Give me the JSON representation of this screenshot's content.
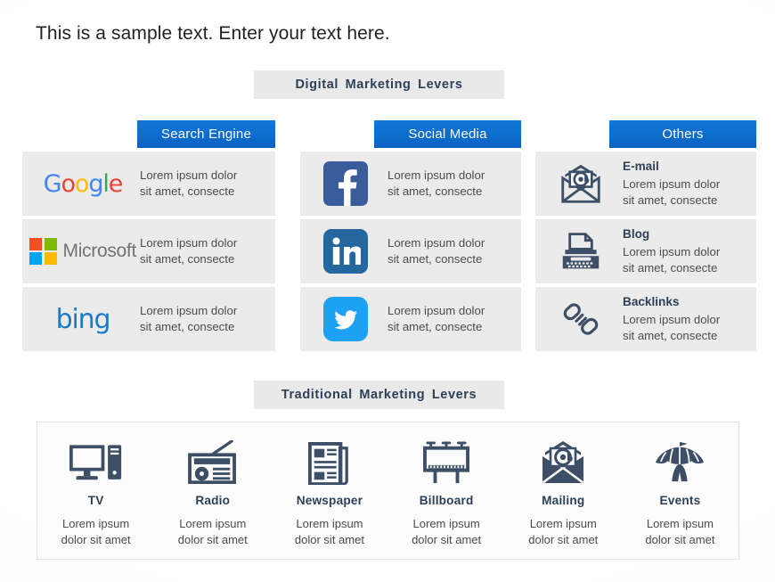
{
  "headline": "This is a sample text. Enter your text here.",
  "sections": {
    "digital_banner": "Digital Marketing Levers",
    "traditional_banner": "Traditional Marketing Levers"
  },
  "colors": {
    "header_blue": "#0d6ed2",
    "banner_gray": "#e9e9e9",
    "card_gray": "#ebebeb",
    "navy_text": "#2e4057",
    "icon_navy": "#3d4f66",
    "facebook_blue": "#3b5c9b",
    "linkedin_blue": "#23679e",
    "twitter_blue": "#1da1f2",
    "bing_blue": "#1a7bc9"
  },
  "digital": {
    "columns": [
      {
        "id": "search-engine",
        "header": "Search Engine",
        "cards": [
          {
            "logo": "google-logo",
            "title": "",
            "line1": "Lorem ipsum dolor",
            "line2": "sit amet, consecte"
          },
          {
            "logo": "microsoft-logo",
            "title": "",
            "line1": "Lorem ipsum dolor",
            "line2": "sit amet, consecte"
          },
          {
            "logo": "bing-logo",
            "title": "",
            "line1": "Lorem ipsum dolor",
            "line2": "sit amet, consecte"
          }
        ]
      },
      {
        "id": "social-media",
        "header": "Social Media",
        "cards": [
          {
            "logo": "facebook-icon",
            "title": "",
            "line1": "Lorem ipsum dolor",
            "line2": "sit amet, consecte"
          },
          {
            "logo": "linkedin-icon",
            "title": "",
            "line1": "Lorem ipsum dolor",
            "line2": "sit amet, consecte"
          },
          {
            "logo": "twitter-icon",
            "title": "",
            "line1": "Lorem ipsum dolor",
            "line2": "sit amet, consecte"
          }
        ]
      },
      {
        "id": "others",
        "header": "Others",
        "cards": [
          {
            "logo": "email-icon",
            "title": "E-mail",
            "line1": "Lorem ipsum dolor",
            "line2": "sit amet, consecte"
          },
          {
            "logo": "typewriter-icon",
            "title": "Blog",
            "line1": "Lorem ipsum dolor",
            "line2": "sit amet, consecte"
          },
          {
            "logo": "chain-link-icon",
            "title": "Backlinks",
            "line1": "Lorem ipsum dolor",
            "line2": "sit amet, consecte"
          }
        ]
      }
    ]
  },
  "traditional": {
    "items": [
      {
        "icon": "desktop-computer-icon",
        "name": "TV",
        "line1": "Lorem ipsum",
        "line2": "dolor sit amet"
      },
      {
        "icon": "radio-icon",
        "name": "Radio",
        "line1": "Lorem ipsum",
        "line2": "dolor sit amet"
      },
      {
        "icon": "newspaper-icon",
        "name": "Newspaper",
        "line1": "Lorem ipsum",
        "line2": "dolor sit amet"
      },
      {
        "icon": "billboard-icon",
        "name": "Billboard",
        "line1": "Lorem ipsum",
        "line2": "dolor sit amet"
      },
      {
        "icon": "envelope-at-icon",
        "name": "Mailing",
        "line1": "Lorem ipsum",
        "line2": "dolor sit amet"
      },
      {
        "icon": "circus-tent-icon",
        "name": "Events",
        "line1": "Lorem ipsum",
        "line2": "dolor sit amet"
      }
    ]
  },
  "logos": {
    "google_letters": [
      "G",
      "o",
      "o",
      "g",
      "l",
      "e"
    ],
    "microsoft_word": "Microsoft",
    "bing_word": "bing",
    "facebook_glyph": "f",
    "linkedin_glyph": "in"
  }
}
